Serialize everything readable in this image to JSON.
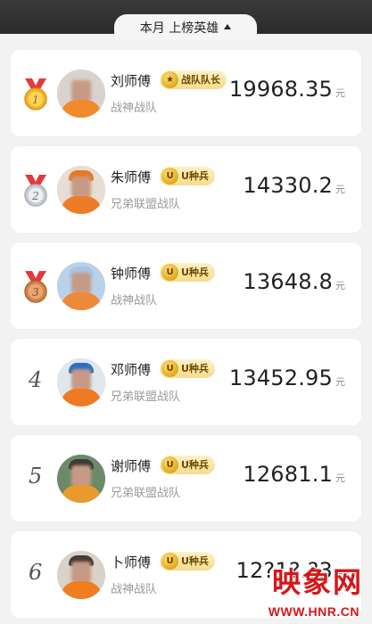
{
  "header": {
    "period_selector_label": "本月 上榜英雄"
  },
  "unit_label": "元",
  "badge_icons": {
    "captain": "star-icon",
    "seed": "u-icon"
  },
  "leaderboard": [
    {
      "rank": "1",
      "name": "刘师傅",
      "badge": "战队队长",
      "badge_icon_text": "★",
      "team": "战神战队",
      "score": "19968.35"
    },
    {
      "rank": "2",
      "name": "朱师傅",
      "badge": "U种兵",
      "badge_icon_text": "U",
      "team": "兄弟联盟战队",
      "score": "14330.2"
    },
    {
      "rank": "3",
      "name": "钟师傅",
      "badge": "U种兵",
      "badge_icon_text": "U",
      "team": "战神战队",
      "score": "13648.8"
    },
    {
      "rank": "4",
      "name": "邓师傅",
      "badge": "U种兵",
      "badge_icon_text": "U",
      "team": "兄弟联盟战队",
      "score": "13452.95"
    },
    {
      "rank": "5",
      "name": "谢师傅",
      "badge": "U种兵",
      "badge_icon_text": "U",
      "team": "兄弟联盟战队",
      "score": "12681.1"
    },
    {
      "rank": "6",
      "name": "卜师傅",
      "badge": "U种兵",
      "badge_icon_text": "U",
      "team": "战神战队",
      "score": "12?1?.?3"
    }
  ],
  "watermark": {
    "brand": "映象网",
    "url": "WWW.HNR.CN"
  },
  "colors": {
    "topbar": "#2b2b2b",
    "background": "#f2f2f2",
    "card": "#ffffff",
    "badge_gold": "#f6dc8c",
    "medal_ribbon": "#e23a3a",
    "gold_medal": "#f0b323",
    "silver_medal": "#c8ccd2",
    "bronze_medal": "#d0824a",
    "watermark": "#d6171a"
  }
}
